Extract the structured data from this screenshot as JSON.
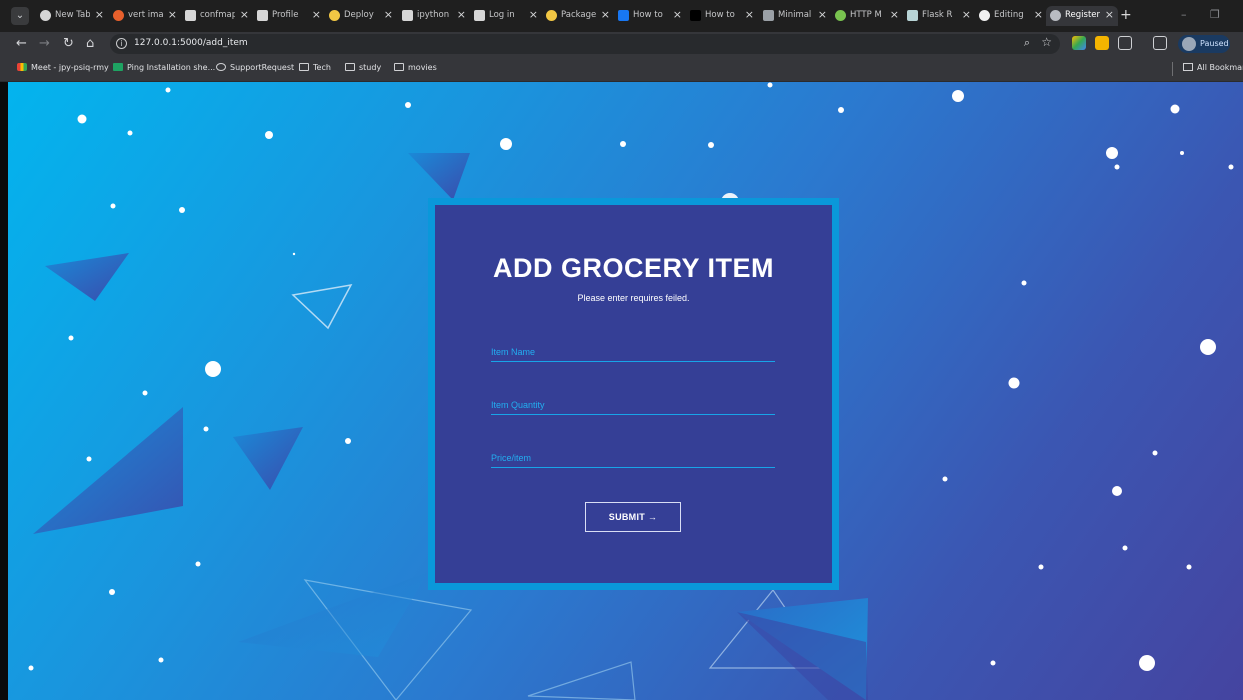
{
  "browser": {
    "tabs": [
      {
        "title": "New Tab",
        "favicon": "globe-icon",
        "active": false
      },
      {
        "title": "vert image",
        "favicon": "brave-icon",
        "active": false
      },
      {
        "title": "confmap",
        "favicon": "document-icon",
        "active": false
      },
      {
        "title": "Profile",
        "favicon": "document-icon",
        "active": false
      },
      {
        "title": "Deploy",
        "favicon": "python-icon",
        "active": false
      },
      {
        "title": "ipython",
        "favicon": "document-icon",
        "active": false
      },
      {
        "title": "Log in",
        "favicon": "document-icon",
        "active": false
      },
      {
        "title": "Package",
        "favicon": "python-icon",
        "active": false
      },
      {
        "title": "How to",
        "favicon": "facebook-icon",
        "active": false
      },
      {
        "title": "How to",
        "favicon": "dev-icon",
        "active": false
      },
      {
        "title": "Minimal",
        "favicon": "grid-icon",
        "active": false
      },
      {
        "title": "HTTP M",
        "favicon": "leaf-icon",
        "active": false
      },
      {
        "title": "Flask R",
        "favicon": "flask-icon",
        "active": false
      },
      {
        "title": "Editing",
        "favicon": "github-icon",
        "active": false
      },
      {
        "title": "Register",
        "favicon": "globe-icon",
        "active": true
      }
    ],
    "address_bar": {
      "url": "127.0.0.1:5000/add_item"
    },
    "profile": {
      "status": "Paused"
    },
    "bookmarks": [
      {
        "label": "Meet - jpy-psiq-rmy",
        "icon": "meet-icon"
      },
      {
        "label": "Ping Installation she...",
        "icon": "sheets-icon"
      },
      {
        "label": "SupportRequest",
        "icon": "globe-icon"
      },
      {
        "label": "Tech",
        "icon": "folder-icon"
      },
      {
        "label": "study",
        "icon": "folder-icon"
      },
      {
        "label": "movies",
        "icon": "folder-icon"
      }
    ],
    "all_bookmarks": "All Bookmarks"
  },
  "form": {
    "title": "ADD GROCERY ITEM",
    "subtitle": "Please enter requires feiled.",
    "fields": {
      "item_name": {
        "placeholder": "Item Name"
      },
      "item_quantity": {
        "placeholder": "Item Quantity"
      },
      "price_item": {
        "placeholder": "Price/item"
      }
    },
    "submit_label": "SUBMIT",
    "submit_arrow": "→"
  },
  "theme": {
    "card_bg": "#353f96",
    "card_border": "#0a98da",
    "field_text": "#22aef0",
    "gradient_start": "#03b4ee",
    "gradient_end": "#4544a0"
  }
}
